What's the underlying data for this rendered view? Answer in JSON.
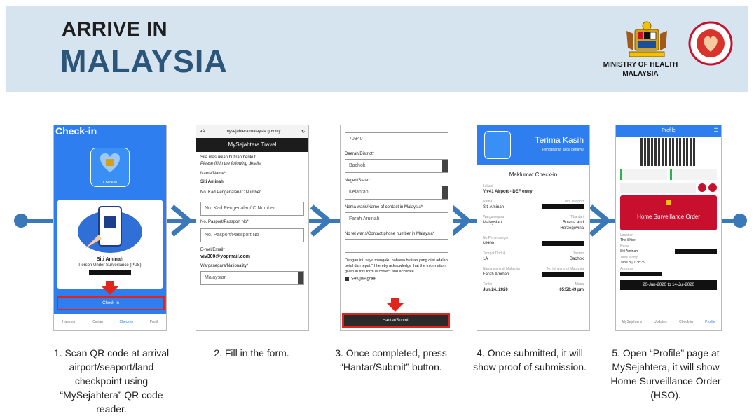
{
  "header": {
    "title_line1": "ARRIVE IN",
    "title_line2": "MALAYSIA",
    "ministry_line1": "MINISTRY OF HEALTH",
    "ministry_line2": "MALAYSIA"
  },
  "screen1": {
    "title": "Check-in",
    "app_badge": "Check-in",
    "name": "Siti Aminah",
    "status": "Person Under Surveillance (PUS)",
    "button": "Check-in",
    "nav": [
      "Halaman",
      "Carian",
      "Check-in",
      "Profil"
    ]
  },
  "screen2": {
    "url": "mysejahtera.malaysia.gov.my",
    "aa": "aA",
    "app_title": "MySejahtera Travel",
    "intro1": "Sila masukkan butiran berikut:",
    "intro2": "Please fill in the following details:",
    "name_label": "Nama/Name*",
    "name_value": "Siti Aminah",
    "ic_label": "No. Kad Pengenalan/IC Number",
    "ic_placeholder": "No. Kad Pengenalan/IC Number",
    "passport_label": "No. Pasport/Passport No*",
    "passport_placeholder": "No. Pasport/Passport No",
    "email_label": "E-mel/Email*",
    "email_value": "viv300@yopmail.com",
    "nationality_label": "Warganegara/Nationality*",
    "nationality_value": "Malaysian"
  },
  "screen3": {
    "postcode": "70340",
    "district_label": "Daerah/District*",
    "district_value": "Bachok",
    "state_label": "Negeri/State*",
    "state_value": "Kelantan",
    "contact_label": "Nama waris/Name of contact in Malaysia*",
    "contact_value": "Farah Aminah",
    "phone_label": "No tel waris/Contact phone number in Malaysia*",
    "declaration": "Dengan ini, saya mengaku bahawa butiran yang diisi adalah betul dan tepat.* I hereby acknowledge that the information given in this form is correct and accurate.",
    "agree": "Setuju/Agree",
    "submit": "Hantar/Submit"
  },
  "screen4": {
    "thanks": "Terima Kasih",
    "thanks_sub": "Pendaftaran anda berjaya!",
    "heading": "Maklumat Check-in",
    "location_label": "Lokasi",
    "location": "Viv41 Airport - DEF entry",
    "name_label": "Nama",
    "name": "Siti Aminah",
    "nationality_label": "Warganegara",
    "nationality": "Malaysian",
    "country_label": "Tiba dari",
    "country": "Bosnia and Herzegovina",
    "flight_label": "No Penerbangan",
    "flight": "MH001",
    "passport_label": "No. Pasport",
    "seat_label": "Tempat Duduk",
    "seat": "1A",
    "district_label": "Daerah",
    "district": "Bachok",
    "contact_label": "Nama waris di Malaysia",
    "contact": "Farah Aminah",
    "contact_phone_label": "No tel waris di Malaysia",
    "date_label": "Tarikh",
    "date": "Jun 24, 2020",
    "time_label": "Masa",
    "time": "05:50:49 pm"
  },
  "screen5": {
    "title": "Profile",
    "order_title": "Home Surveillance Order",
    "location_label": "Location",
    "location": "The Shire",
    "name_label": "Name",
    "name": "Siti Aminah",
    "timestamp_label": "Time stamp",
    "timestamp": "June 8 | 7:38:39",
    "address_label": "Address",
    "period": "20-Jun-2020 to 14-Jul-2020",
    "nav": [
      "MySejahtera",
      "Updates",
      "Check-in",
      "Profile"
    ]
  },
  "captions": [
    "1. Scan QR code at arrival airport/seaport/land checkpoint using “MySejahtera” QR code reader.",
    "2. Fill in the form.",
    "3. Once completed, press “Hantar/Submit” button.",
    "4. Once submitted, it will show proof of submission.",
    "5. Open “Profile” page at MySejahtera, it will show Home Surveillance Order (HSO)."
  ],
  "colors": {
    "accent_blue": "#3a78b8",
    "title_blue": "#2c5679",
    "banner_bg": "#d6e4ef",
    "alert_red": "#c8102e",
    "app_blue": "#2f7ef0"
  }
}
